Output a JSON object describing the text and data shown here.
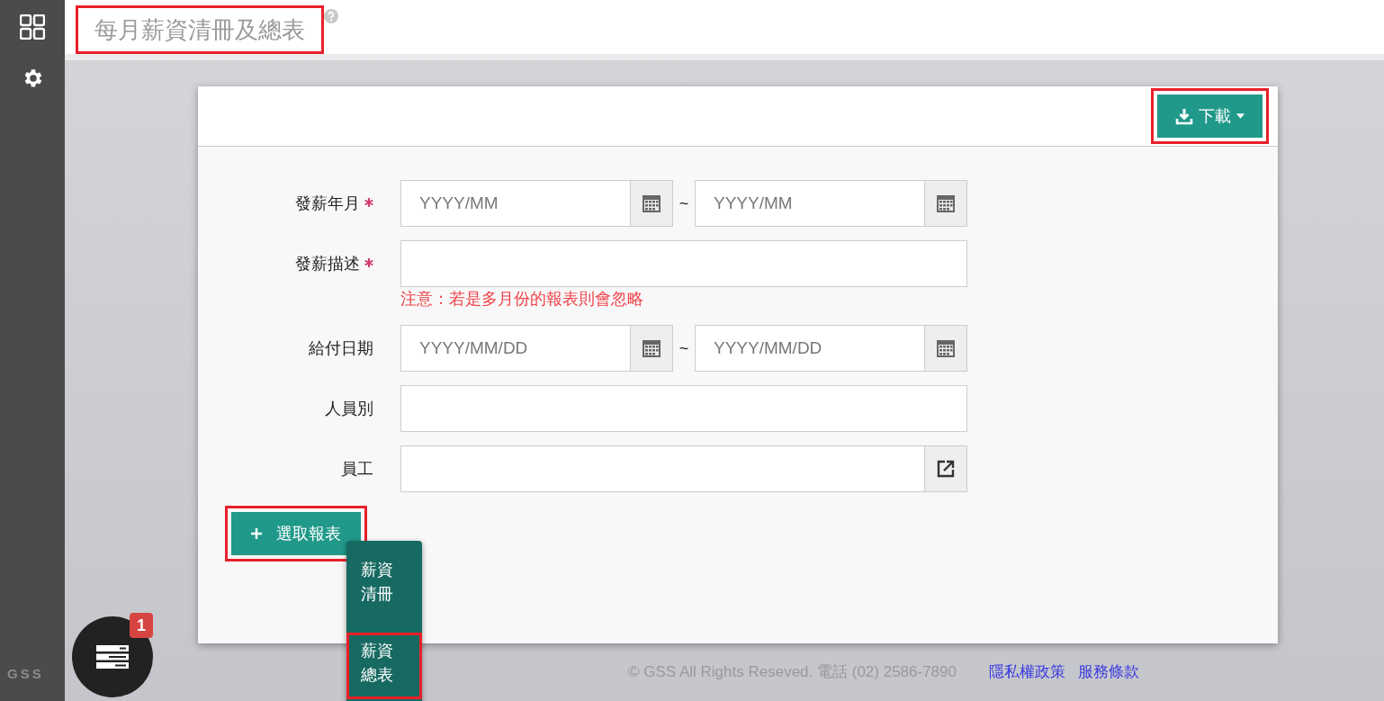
{
  "sidebar": {
    "logo": "GSS"
  },
  "page_title": {
    "text": "每月薪資清冊及總表",
    "highlighted": true
  },
  "card_header": {
    "download_button": {
      "label": "下載",
      "highlighted": true
    }
  },
  "form": {
    "fields": [
      {
        "label": "發薪年月",
        "required": true,
        "kind": "date_range",
        "placeholders": [
          "YYYY/MM",
          "YYYY/MM"
        ],
        "separator": "~"
      },
      {
        "label": "發薪描述",
        "required": true,
        "kind": "text",
        "note": "注意：若是多月份的報表則會忽略"
      },
      {
        "label": "給付日期",
        "required": false,
        "kind": "date_range",
        "placeholders": [
          "YYYY/MM/DD",
          "YYYY/MM/DD"
        ],
        "separator": "~"
      },
      {
        "label": "人員別",
        "required": false,
        "kind": "text"
      },
      {
        "label": "員工",
        "required": false,
        "kind": "lookup"
      }
    ]
  },
  "select_report_button": {
    "label": "選取報表",
    "highlighted": true
  },
  "report_menu": {
    "items": [
      {
        "label": "薪資清冊",
        "highlighted": false
      },
      {
        "label": "薪資總表",
        "highlighted": true
      }
    ]
  },
  "fab": {
    "badge": "1"
  },
  "footer": {
    "copyright": "© GSS All Rights Reseved. 電話 (02) 2586-7890",
    "links": [
      "隱私權政策",
      "服務條款"
    ]
  }
}
